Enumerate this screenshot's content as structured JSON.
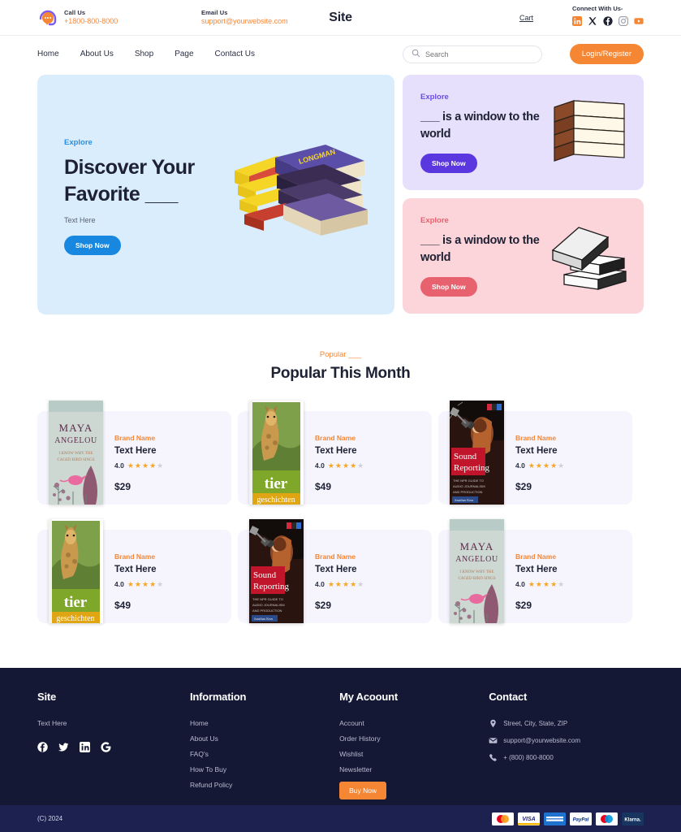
{
  "topbar": {
    "call_label": "Call Us",
    "phone": "+1800-800-8000",
    "email_label": "Email Us",
    "email": "support@yourwebsite.com",
    "site_title": "Site",
    "cart": "Cart",
    "connect_label": "Connect With Us-",
    "socials": [
      {
        "name": "linkedin-icon",
        "color": "#f58634"
      },
      {
        "name": "x-twitter-icon",
        "color": "#1d2133"
      },
      {
        "name": "facebook-icon",
        "color": "#1d2133"
      },
      {
        "name": "instagram-icon",
        "color": "#9a9aa8"
      },
      {
        "name": "youtube-icon",
        "color": "#f58634"
      }
    ]
  },
  "nav": {
    "links": [
      "Home",
      "About Us",
      "Shop",
      "Page",
      "Contact Us"
    ],
    "search_placeholder": "Search",
    "search_value": "",
    "login_label": "Login/Register"
  },
  "hero": {
    "main": {
      "eyebrow": "Explore",
      "title": "Discover Your Favorite ___",
      "subtitle": "Text Here",
      "button": "Shop Now",
      "bg": "#d9edfd",
      "accent": "#1787e0"
    },
    "cards": [
      {
        "eyebrow": "Explore",
        "title": "___ is a window to the world",
        "button": "Shop Now",
        "bg": "#e6e0fd",
        "accent": "#5b37e0"
      },
      {
        "eyebrow": "Explore",
        "title": "___ is a window to the world",
        "button": "Shop Now",
        "bg": "#fcd5da",
        "accent": "#e8616f"
      }
    ]
  },
  "popular": {
    "eyebrow": "Popular ___",
    "title": "Popular This Month",
    "products": [
      {
        "brand": "Brand Name",
        "name": "Text Here",
        "rating": "4.0",
        "stars_on": 4,
        "stars_off": 1,
        "price": "$29",
        "cover": "maya"
      },
      {
        "brand": "Brand Name",
        "name": "Text Here",
        "rating": "4.0",
        "stars_on": 4,
        "stars_off": 1,
        "price": "$49",
        "cover": "tier"
      },
      {
        "brand": "Brand Name",
        "name": "Text Here",
        "rating": "4.0",
        "stars_on": 4,
        "stars_off": 1,
        "price": "$29",
        "cover": "sound"
      },
      {
        "brand": "Brand Name",
        "name": "Text Here",
        "rating": "4.0",
        "stars_on": 4,
        "stars_off": 1,
        "price": "$49",
        "cover": "tier"
      },
      {
        "brand": "Brand Name",
        "name": "Text Here",
        "rating": "4.0",
        "stars_on": 4,
        "stars_off": 1,
        "price": "$29",
        "cover": "sound"
      },
      {
        "brand": "Brand Name",
        "name": "Text Here",
        "rating": "4.0",
        "stars_on": 4,
        "stars_off": 1,
        "price": "$29",
        "cover": "maya"
      }
    ]
  },
  "footer": {
    "brand": {
      "heading": "Site",
      "text": "Text Here",
      "socials": [
        "facebook-icon",
        "twitter-icon",
        "linkedin-icon",
        "google-icon"
      ]
    },
    "information": {
      "heading": "Information",
      "links": [
        "Home",
        "About Us",
        "FAQ's",
        "How To Buy",
        "Refund Policy"
      ]
    },
    "account": {
      "heading": "My Acoount",
      "links": [
        "Account",
        "Order History",
        "Wishlist",
        "Newsletter"
      ],
      "buy_button": "Buy Now"
    },
    "contact": {
      "heading": "Contact",
      "address": "Street, City, State, ZIP",
      "email": "support@yourwebsite.com",
      "phone": "+ (800) 800-8000"
    },
    "copyright": "(C) 2024",
    "payments": [
      "Mastercard",
      "VISA",
      "AMEX",
      "PayPal",
      "Maestro",
      "Klarna"
    ]
  }
}
